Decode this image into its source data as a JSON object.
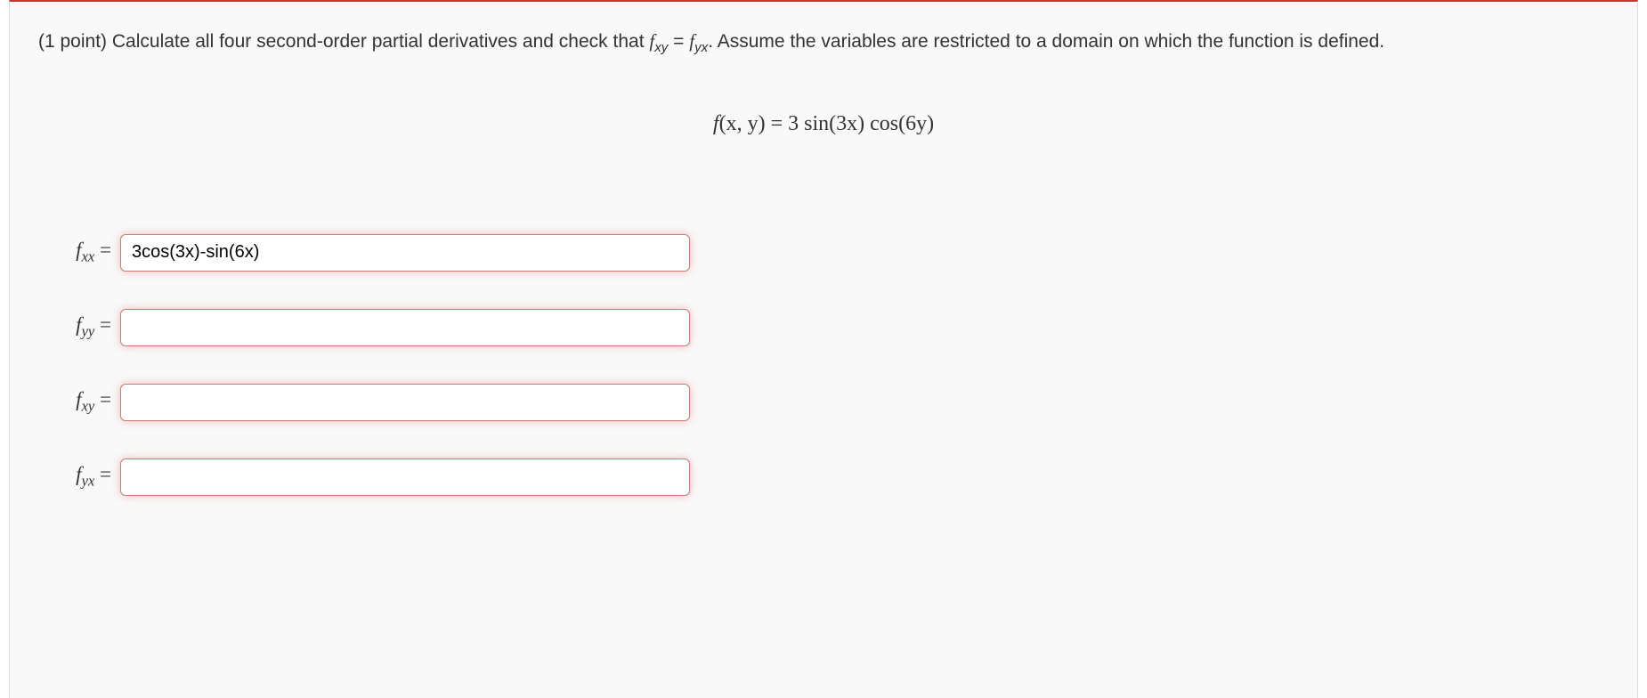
{
  "problem": {
    "points_prefix": "(1 point) ",
    "text_before_fxy": "Calculate all four second-order partial derivatives and check that ",
    "fxy_symbol": "f",
    "fxy_sub": "xy",
    "equals": " = ",
    "fyx_symbol": "f",
    "fyx_sub": "yx",
    "text_after": ". Assume the variables are restricted to a domain on which the function is defined."
  },
  "equation": {
    "lhs_f": "f",
    "lhs_args": "(x, y)",
    "eq": " = ",
    "rhs_a": "3 ",
    "rhs_sin": "sin",
    "rhs_b": "(3x) ",
    "rhs_cos": "cos",
    "rhs_c": "(6y)"
  },
  "answers": {
    "fxx": {
      "f": "f",
      "sub": "xx",
      "eq": " =",
      "value": "3cos(3x)-sin(6x)"
    },
    "fyy": {
      "f": "f",
      "sub": "yy",
      "eq": " =",
      "value": ""
    },
    "fxy": {
      "f": "f",
      "sub": "xy",
      "eq": " =",
      "value": ""
    },
    "fyx": {
      "f": "f",
      "sub": "yx",
      "eq": " =",
      "value": ""
    }
  }
}
